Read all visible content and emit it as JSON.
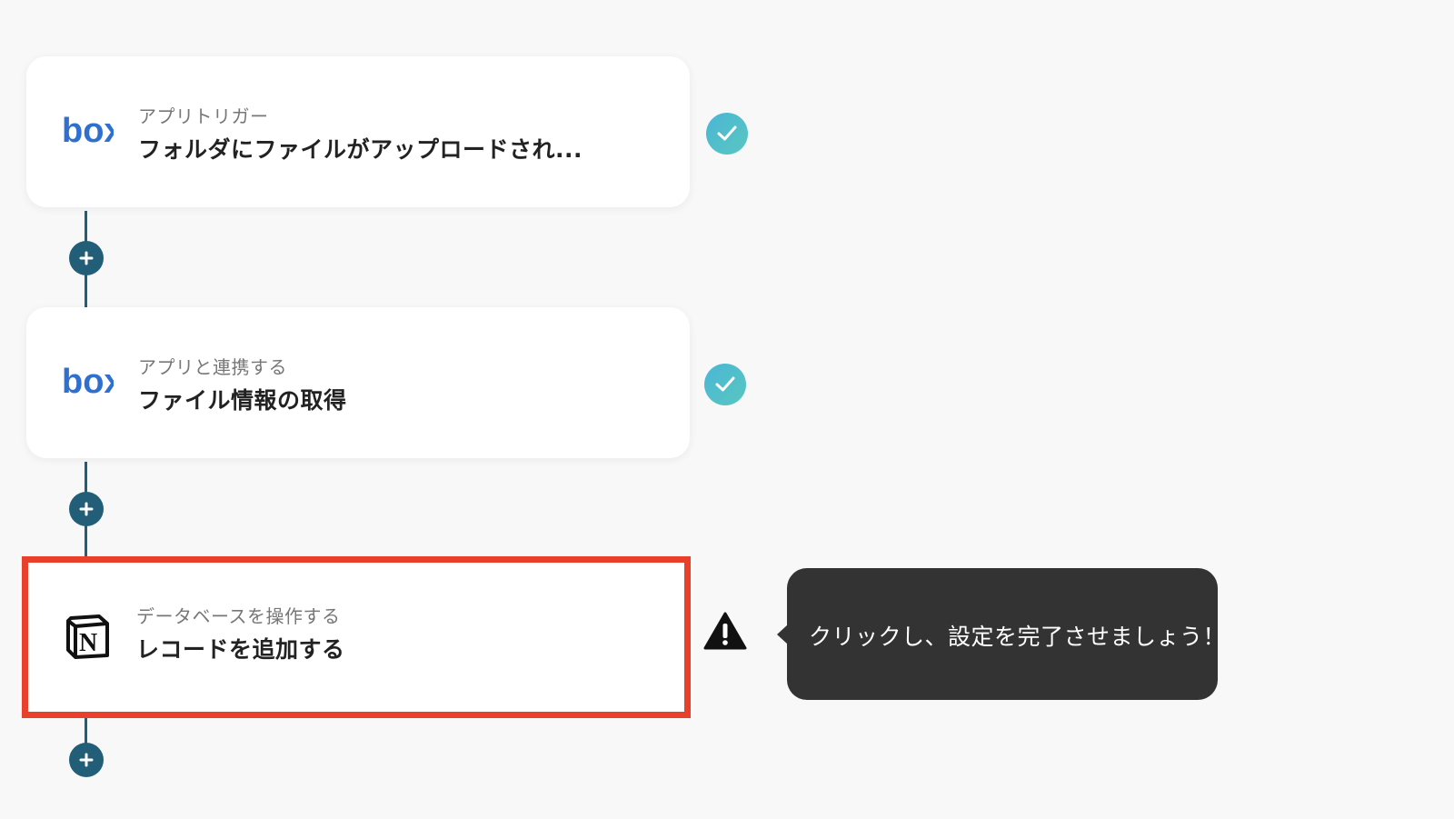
{
  "steps": [
    {
      "app_icon": "box-logo",
      "app_logo_text": "box",
      "subtitle": "アプリトリガー",
      "title": "フォルダにファイルがアップロードされ...",
      "status": "complete"
    },
    {
      "app_icon": "box-logo",
      "app_logo_text": "box",
      "subtitle": "アプリと連携する",
      "title": "ファイル情報の取得",
      "status": "complete"
    },
    {
      "app_icon": "notion-logo",
      "app_logo_text": "N",
      "subtitle": "データベースを操作する",
      "title": "レコードを追加する",
      "status": "warning"
    }
  ],
  "add_button_icon": "plus-icon",
  "tooltip": {
    "text": "クリックし、設定を完了させましょう！"
  },
  "colors": {
    "connector": "#1f5f7a",
    "add_button": "#235e78",
    "check_gradient_start": "#4bb6d6",
    "check_gradient_end": "#58c7c0",
    "highlight_border": "#e8402a",
    "box_brand": "#2f6fd0",
    "tooltip_bg": "#333333"
  }
}
